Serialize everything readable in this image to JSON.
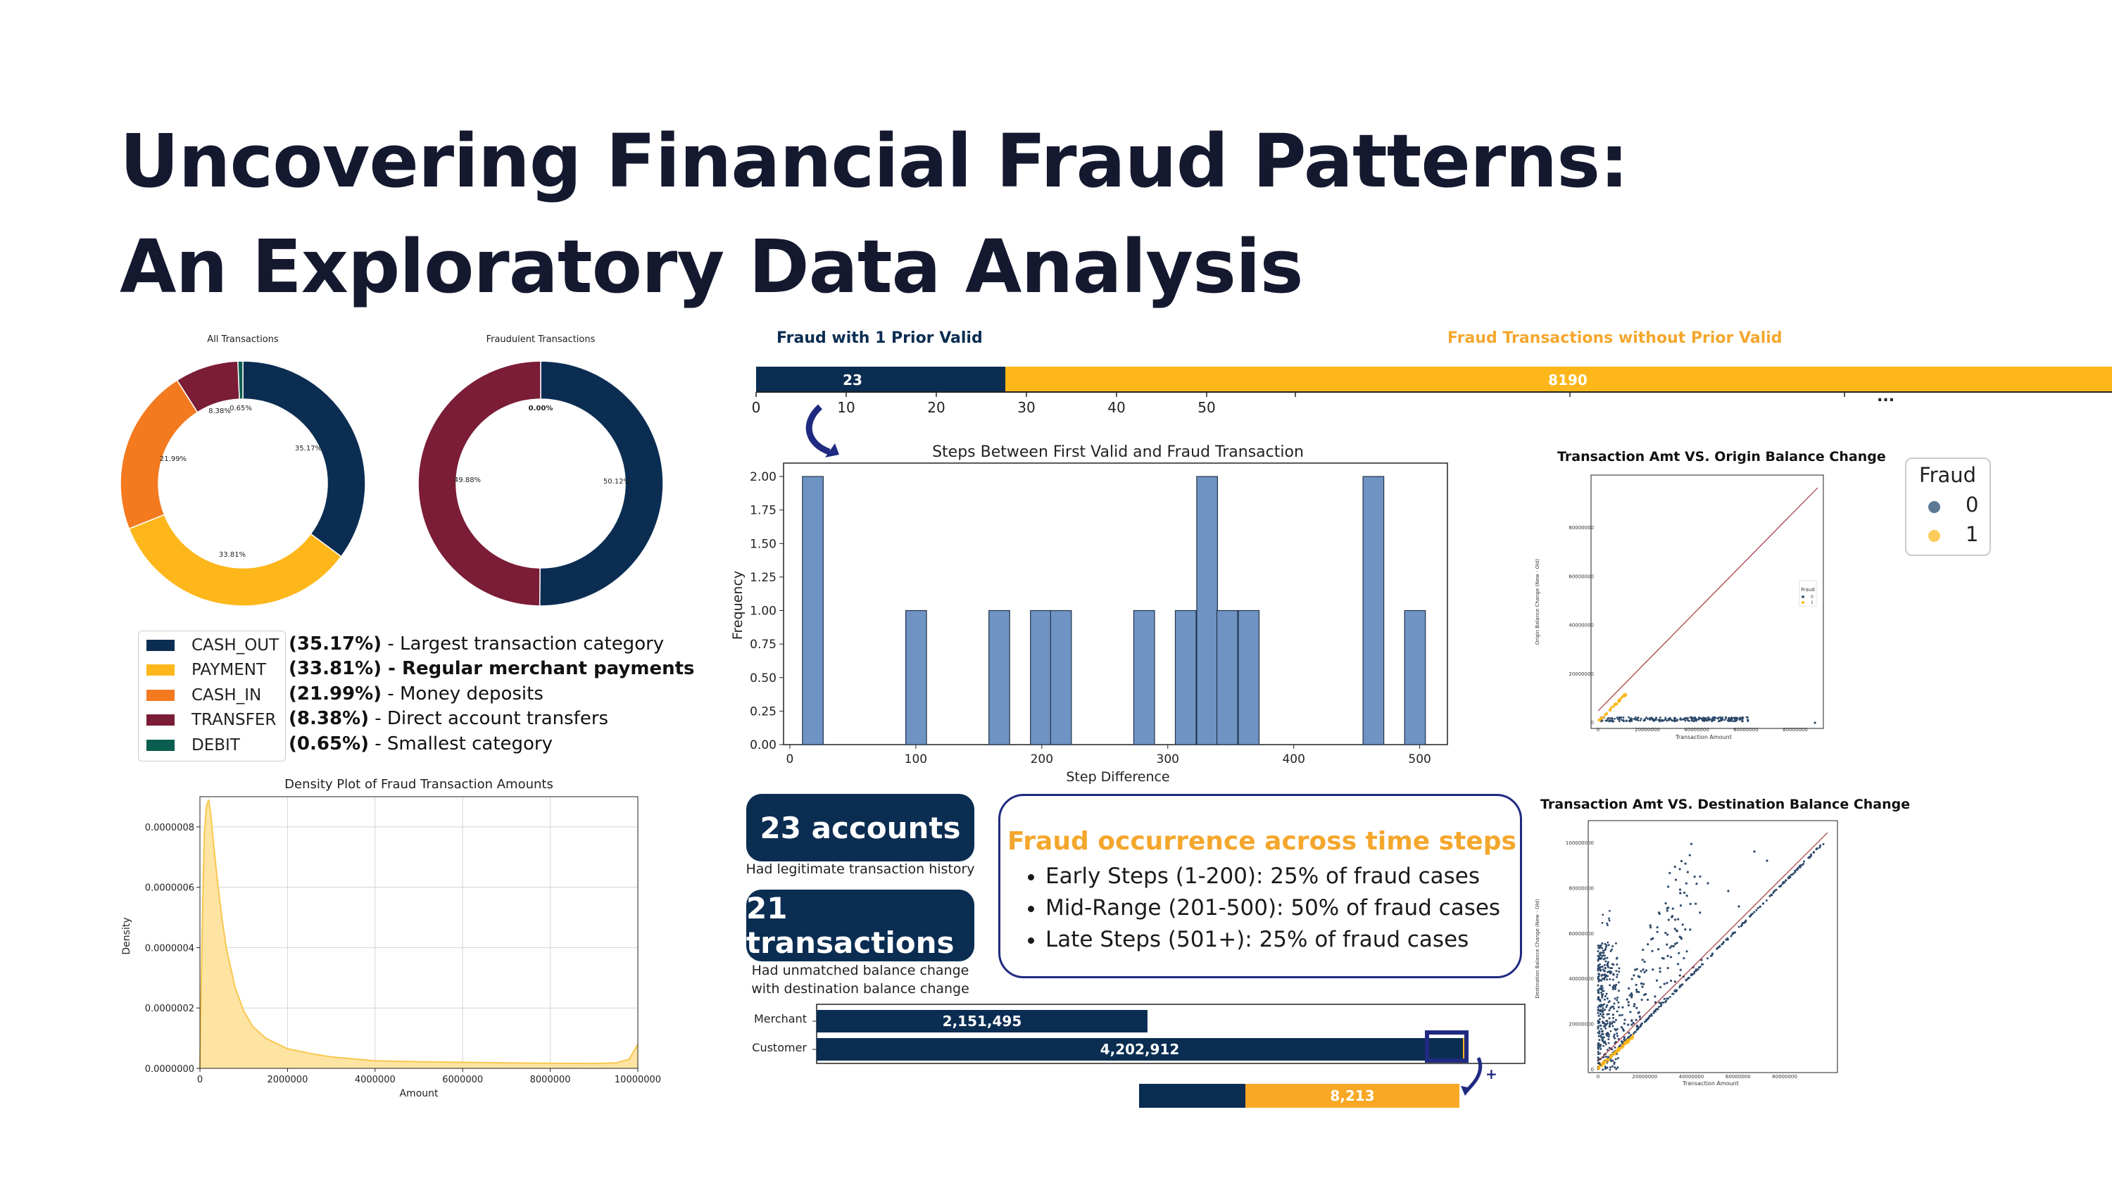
{
  "title_line1": "Uncovering Financial Fraud Patterns:",
  "title_line2": "An Exploratory Data Analysis",
  "colors": {
    "navy": "#0b2d52",
    "orange_dark": "#f47a1f",
    "gold": "#fdb71a",
    "maroon": "#7b1d37",
    "green": "#0b5e4f",
    "bar_blue": "#6f93c3",
    "accent_orange": "#f4a72d"
  },
  "donut_all": {
    "title": "All Transactions",
    "slices": [
      {
        "name": "CASH_OUT",
        "pct": 35.17,
        "label": "35.17%",
        "color": "#0b2d52"
      },
      {
        "name": "PAYMENT",
        "pct": 33.81,
        "label": "33.81%",
        "color": "#fdb71a"
      },
      {
        "name": "CASH_IN",
        "pct": 21.99,
        "label": "21.99%",
        "color": "#f47a1f"
      },
      {
        "name": "TRANSFER",
        "pct": 8.38,
        "label": "8.38%",
        "color": "#7b1d37"
      },
      {
        "name": "DEBIT",
        "pct": 0.65,
        "label": "0.65%",
        "color": "#0b5e4f"
      }
    ]
  },
  "donut_fraud": {
    "title": "Fraudulent Transactions",
    "slices": [
      {
        "name": "CASH_OUT",
        "pct": 50.12,
        "label": "50.12%",
        "color": "#0b2d52"
      },
      {
        "name": "TRANSFER",
        "pct": 49.88,
        "label": "49.88%",
        "color": "#7b1d37"
      },
      {
        "name": "other",
        "pct": 0.0,
        "label": "0.00%",
        "color": "#fdb71a"
      }
    ]
  },
  "legend": {
    "items": [
      {
        "name": "CASH_OUT",
        "color": "#0b2d52",
        "pct": "(35.17%)",
        "desc": " - Largest transaction category",
        "bold": false
      },
      {
        "name": "PAYMENT",
        "color": "#fdb71a",
        "pct": "(33.81%)",
        "desc": " - Regular merchant payments",
        "bold": true
      },
      {
        "name": "CASH_IN",
        "color": "#f47a1f",
        "pct": "(21.99%)",
        "desc": " - Money deposits",
        "bold": false
      },
      {
        "name": "TRANSFER",
        "color": "#7b1d37",
        "pct": "(8.38%)",
        "desc": " - Direct account transfers",
        "bold": false
      },
      {
        "name": "DEBIT",
        "color": "#0b5e4f",
        "pct": "(0.65%)",
        "desc": " - Smallest category",
        "bold": false
      }
    ]
  },
  "prior_bar": {
    "label_left": "Fraud with 1 Prior Valid",
    "label_right": "Fraud Transactions without Prior Valid",
    "values": [
      23,
      8190
    ],
    "value_labels": [
      "23",
      "8190"
    ],
    "ticks": [
      0,
      10,
      20,
      30,
      40,
      50
    ],
    "ellipsis": "..."
  },
  "chart_data": [
    {
      "type": "bar",
      "title": "Steps Between First Valid and Fraud Transaction",
      "xlabel": "Step Difference",
      "ylabel": "Frequency",
      "xlim": [
        -5,
        522
      ],
      "ylim": [
        0,
        2.1
      ],
      "bin_width": 16.5,
      "bins": [
        {
          "x": 10,
          "count": 2
        },
        {
          "x": 92,
          "count": 1
        },
        {
          "x": 158,
          "count": 1
        },
        {
          "x": 191,
          "count": 1
        },
        {
          "x": 207,
          "count": 1
        },
        {
          "x": 273,
          "count": 1
        },
        {
          "x": 306,
          "count": 1
        },
        {
          "x": 323,
          "count": 2
        },
        {
          "x": 339,
          "count": 1
        },
        {
          "x": 356,
          "count": 1
        },
        {
          "x": 455,
          "count": 2
        },
        {
          "x": 488,
          "count": 1
        }
      ],
      "xticks": [
        0,
        100,
        200,
        300,
        400,
        500
      ],
      "yticks": [
        "0.00",
        "0.25",
        "0.50",
        "0.75",
        "1.00",
        "1.25",
        "1.50",
        "1.75",
        "2.00"
      ]
    },
    {
      "type": "area",
      "title": "Density Plot of Fraud Transaction Amounts",
      "xlabel": "Amount",
      "ylabel": "Density",
      "xlim": [
        0,
        10000000
      ],
      "ylim": [
        0,
        9e-07
      ],
      "x": [
        0,
        50000,
        100000,
        150000,
        200000,
        250000,
        300000,
        400000,
        500000,
        600000,
        800000,
        1000000,
        1200000,
        1500000,
        2000000,
        2500000,
        3000000,
        4000000,
        5000000,
        6000000,
        7000000,
        8000000,
        9000000,
        9500000,
        9800000,
        10000000
      ],
      "y": [
        0,
        4.5e-07,
        7.8e-07,
        8.7e-07,
        8.9e-07,
        8.4e-07,
        7.6e-07,
        6.2e-07,
        5e-07,
        4e-07,
        2.7e-07,
        1.9e-07,
        1.4e-07,
        1e-07,
        6.5e-08,
        5e-08,
        3.8e-08,
        2.5e-08,
        2.2e-08,
        2e-08,
        1.8e-08,
        1.7e-08,
        1.6e-08,
        1.8e-08,
        3e-08,
        8e-08
      ],
      "xticks": [
        "0",
        "2000000",
        "4000000",
        "6000000",
        "8000000",
        "10000000"
      ],
      "yticks": [
        "0.0000000",
        "0.0000002",
        "0.0000004",
        "0.0000006",
        "0.0000008"
      ],
      "color": "#f9c74f"
    },
    {
      "type": "bar",
      "title": "",
      "categories": [
        "Merchant",
        "Customer"
      ],
      "values": [
        2151495,
        4202912
      ],
      "value_labels": [
        "2,151,495",
        "4,202,912"
      ]
    },
    {
      "type": "bar",
      "title": "",
      "values": [
        8213
      ],
      "value_labels": [
        "8,213"
      ]
    }
  ],
  "stats": {
    "accounts_title": "23 accounts",
    "accounts_note": "Had legitimate transaction history",
    "transactions_title": "21 transactions",
    "transactions_note_1": "Had unmatched balance change",
    "transactions_note_2": "with destination balance change"
  },
  "fraud_time": {
    "heading": "Fraud occurrence across time steps",
    "bullets": [
      "Early Steps (1-200): 25% of fraud cases",
      "Mid-Range (201-500): 50% of fraud cases",
      "Late Steps (501+): 25% of fraud cases"
    ]
  },
  "scatter_origin": {
    "title": "Transaction Amt VS. Origin Balance Change",
    "ylabel": "Origin Balance Change (New - Old)",
    "xlabel": "Transaction Amount",
    "xticks": [
      "0",
      "20000000",
      "40000000",
      "60000000",
      "80000000"
    ],
    "yticks": [
      "0",
      "20000000",
      "40000000",
      "60000000",
      "80000000"
    ],
    "mini_legend_title": "Fraud",
    "mini_legend": [
      "0",
      "1"
    ]
  },
  "scatter_dest": {
    "title": "Transaction Amt VS. Destination Balance Change",
    "ylabel": "Destination Balance Change (New - Old)",
    "xlabel": "Transaction Amount",
    "xticks": [
      "0",
      "20000000",
      "40000000",
      "60000000",
      "80000000"
    ],
    "yticks": [
      "0",
      "20000000",
      "40000000",
      "60000000",
      "80000000",
      "100000000"
    ]
  },
  "fraud_legend": {
    "title": "Fraud",
    "items": [
      "0",
      "1"
    ]
  }
}
